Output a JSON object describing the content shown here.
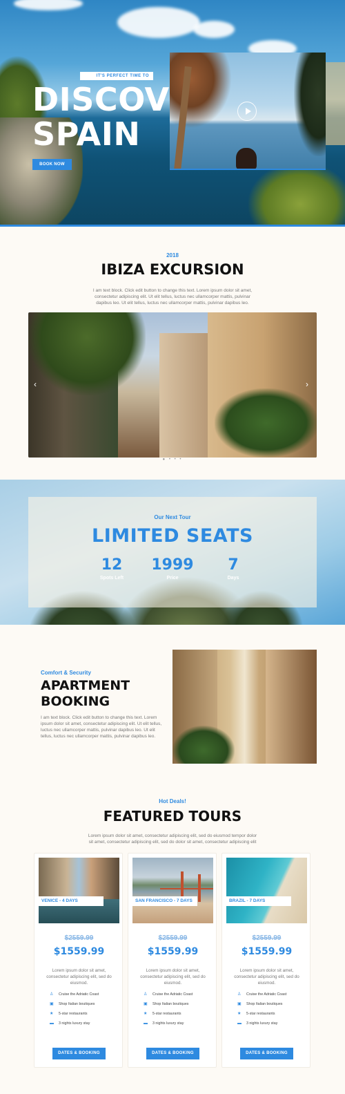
{
  "hero": {
    "tagline": "IT'S PERFECT TIME TO",
    "title_line1": "DISCOVER",
    "title_line2": "SPAIN",
    "cta": "BOOK NOW"
  },
  "ibiza": {
    "year": "2018",
    "title": "IBIZA EXCURSION",
    "text": "I am text block. Click edit button to change this text. Lorem ipsum dolor sit amet, consectetur adipiscing elit. Ut elit tellus, luctus nec ullamcorper mattis, pulvinar dapibus leo. Ut elit tellus, luctus nec ullamcorper mattis, pulvinar dapibus leo.",
    "prev_arrow": "‹",
    "next_arrow": "›",
    "dots": "● • • •"
  },
  "seats": {
    "label": "Our Next Tour",
    "title": "LIMITED SEATS",
    "stats": [
      {
        "value": "12",
        "label": "Spots Left"
      },
      {
        "value": "1999",
        "label": "Price"
      },
      {
        "value": "7",
        "label": "Days"
      }
    ]
  },
  "apartment": {
    "label": "Comfort & Security",
    "title": "APARTMENT BOOKING",
    "text": "I am text block. Click edit button to change this text. Lorem ipsum dolor sit amet, consectetur adipiscing elit. Ut elit tellus, luctus nec ullamcorper mattis, pulvinar dapibus leo. Ut elit tellus, luctus nec ullamcorper mattis, pulvinar dapibus leo."
  },
  "tours": {
    "label": "Hot Deals!",
    "title": "FEATURED TOURS",
    "text": "Lorem ipsum dolor sit amet, consectetur adipiscing elit, sed do eiusmod tempor dolor sit amet, consectetur adipiscing elit, sed do dolor sit amet, consectetur adipiscing elit",
    "cards": [
      {
        "tag": "VENICE - 4 DAYS",
        "old_price": "$2559.99",
        "price": "$1559.99",
        "desc": "Lorem ipsum dolor sit amet, consectetur adipiscing elit, sed do eiusmod.",
        "features": [
          "Cruise the Adriatic Coast",
          "Shop Italian boutiques",
          "5-star restaurants",
          "3 nights luxury stay"
        ],
        "button": "DATES & BOOKING"
      },
      {
        "tag": "SAN FRANCISCO - 7 DAYS",
        "old_price": "$2559.99",
        "price": "$1559.99",
        "desc": "Lorem ipsum dolor sit amet, consectetur adipiscing elit, sed do eiusmod.",
        "features": [
          "Cruise the Adriatic Coast",
          "Shop Italian boutiques",
          "5-star restaurants",
          "3 nights luxury stay"
        ],
        "button": "DATES & BOOKING"
      },
      {
        "tag": "BRAZIL - 7 DAYS",
        "old_price": "$2559.99",
        "price": "$1559.99",
        "desc": "Lorem ipsum dolor sit amet, consectetur adipiscing elit, sed do eiusmod.",
        "features": [
          "Cruise the Adriatic Coast",
          "Shop Italian boutiques",
          "5-star restaurants",
          "3 nights luxury stay"
        ],
        "button": "DATES & BOOKING"
      }
    ],
    "feature_icons": [
      "person-icon",
      "bag-icon",
      "star-icon",
      "bed-icon"
    ]
  },
  "colors": {
    "accent": "#2e8ae0",
    "background": "#fdfaf5",
    "text": "#111111",
    "muted": "#777777"
  }
}
